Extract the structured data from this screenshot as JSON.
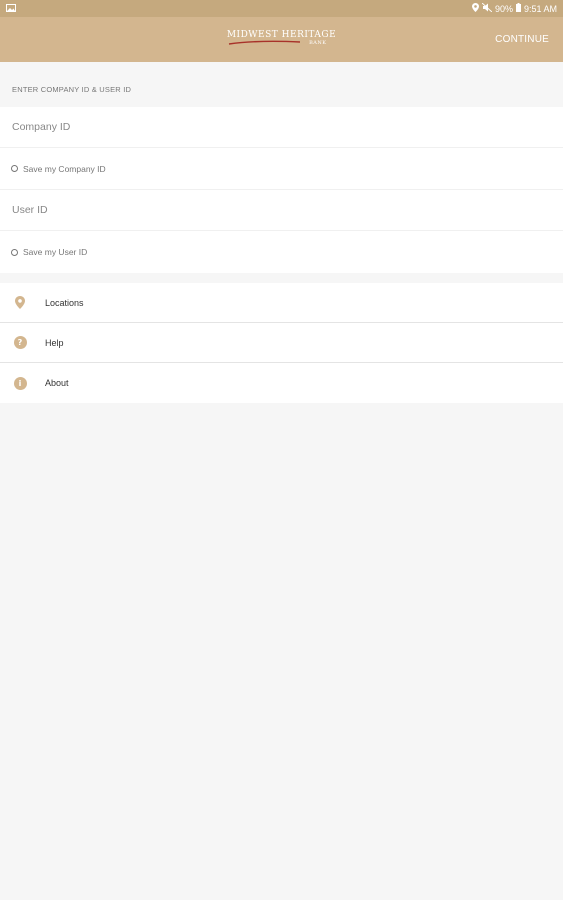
{
  "status_bar": {
    "battery_percent": "90%",
    "time": "9:51 AM",
    "icons": [
      "image-icon",
      "location-icon",
      "mute-icon",
      "battery-icon"
    ]
  },
  "app_bar": {
    "logo_text": "MIDWEST HERITAGE",
    "logo_sub": "BANK",
    "continue_label": "CONTINUE"
  },
  "login": {
    "section_header": "ENTER COMPANY ID & USER ID",
    "company_id_placeholder": "Company ID",
    "save_company_id_label": "Save my Company ID",
    "user_id_placeholder": "User ID",
    "save_user_id_label": "Save my User ID"
  },
  "menu": {
    "items": [
      {
        "label": "Locations",
        "icon": "location-pin-icon"
      },
      {
        "label": "Help",
        "icon": "help-icon"
      },
      {
        "label": "About",
        "icon": "info-icon"
      }
    ]
  },
  "colors": {
    "status_bar": "#c5a97e",
    "app_bar": "#d3b68f",
    "accent": "#d3b68f",
    "background": "#f6f6f6"
  }
}
